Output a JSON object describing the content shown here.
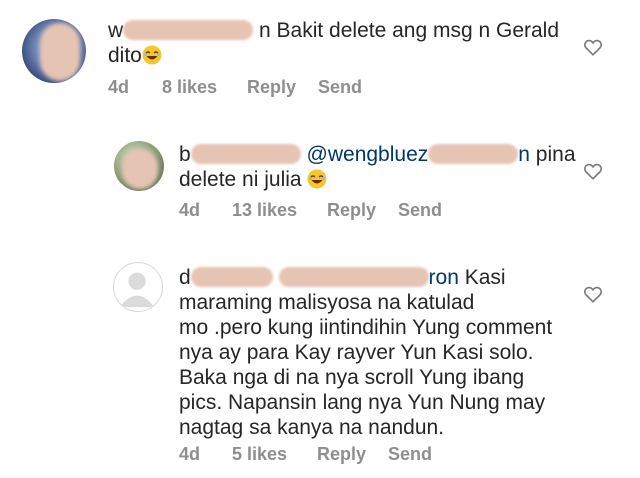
{
  "comments": [
    {
      "username": "w",
      "text": "n Bakit delete ang msg n Gerald",
      "text_line2": "dito",
      "time": "4d",
      "likes": "8 likes",
      "reply": "Reply",
      "send": "Send"
    },
    {
      "username": "b",
      "mention": "@wengbluez",
      "mention_tail": "n",
      "text": "pina",
      "text_line2": "delete ni julia",
      "time": "4d",
      "likes": "13 likes",
      "reply": "Reply",
      "send": "Send"
    },
    {
      "username": "d",
      "mention_tail": "ron",
      "text": "Kasi",
      "lines": [
        "maraming malisyosa na katulad",
        "mo .pero kung iintindihin Yung comment",
        "nya ay para Kay rayver Yun Kasi solo.",
        "Baka nga di na nya scroll Yung ibang",
        "pics. Napansin lang nya Yun Nung may",
        "nagtag sa kanya na nandun."
      ],
      "time": "4d",
      "likes": "5 likes",
      "reply": "Reply",
      "send": "Send"
    }
  ],
  "icons": {
    "heart": "heart-outline-icon",
    "emoji": "laughing-face-emoji",
    "avatar_default": "default-avatar-icon"
  }
}
